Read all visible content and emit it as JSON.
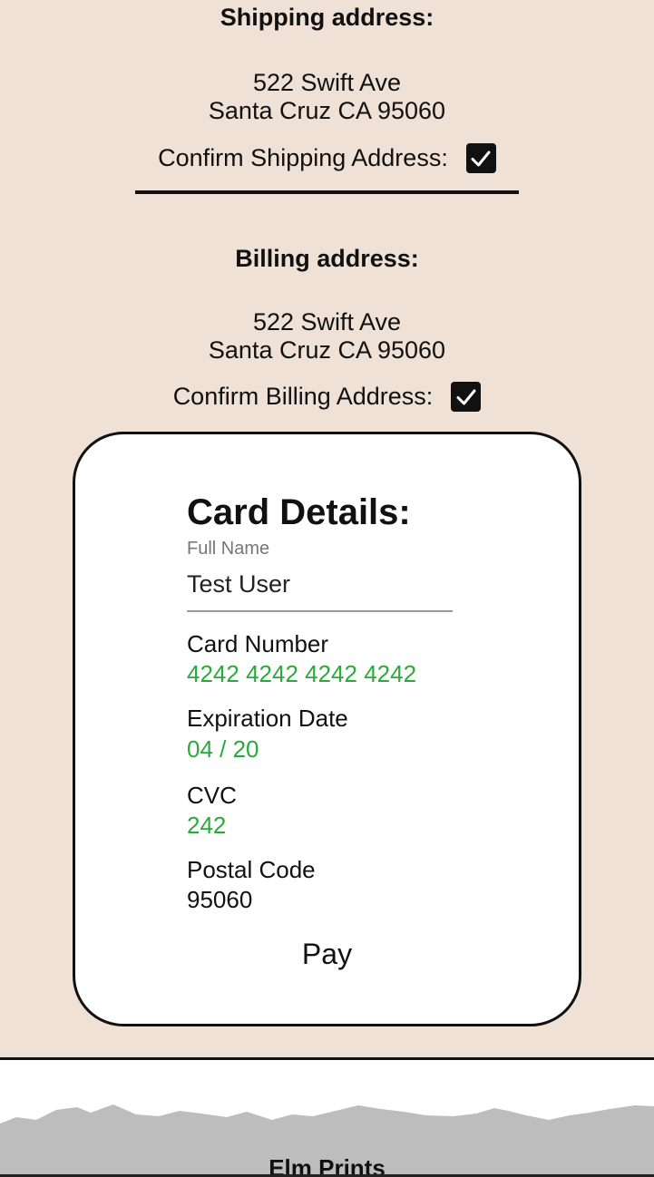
{
  "shipping": {
    "heading": "Shipping address:",
    "line1": "522 Swift Ave",
    "line2": "Santa Cruz CA 95060",
    "confirm_label": "Confirm Shipping Address:",
    "confirmed": true
  },
  "billing": {
    "heading": "Billing address:",
    "line1": "522 Swift Ave",
    "line2": "Santa Cruz CA 95060",
    "confirm_label": "Confirm Billing Address:",
    "confirmed": true
  },
  "card": {
    "title": "Card Details:",
    "full_name_label": "Full Name",
    "full_name_value": "Test User",
    "card_number_label": "Card Number",
    "card_number_value": "4242 4242 4242 4242",
    "expiration_label": "Expiration Date",
    "expiration_value": "04 / 20",
    "cvc_label": "CVC",
    "cvc_value": "242",
    "postal_label": "Postal Code",
    "postal_value": "95060",
    "pay_label": "Pay"
  },
  "footer": {
    "brand": "Elm Prints"
  },
  "colors": {
    "background": "#efe1d6",
    "valid_text": "#2aaa3a",
    "footer_band": "#bdbdbd"
  }
}
